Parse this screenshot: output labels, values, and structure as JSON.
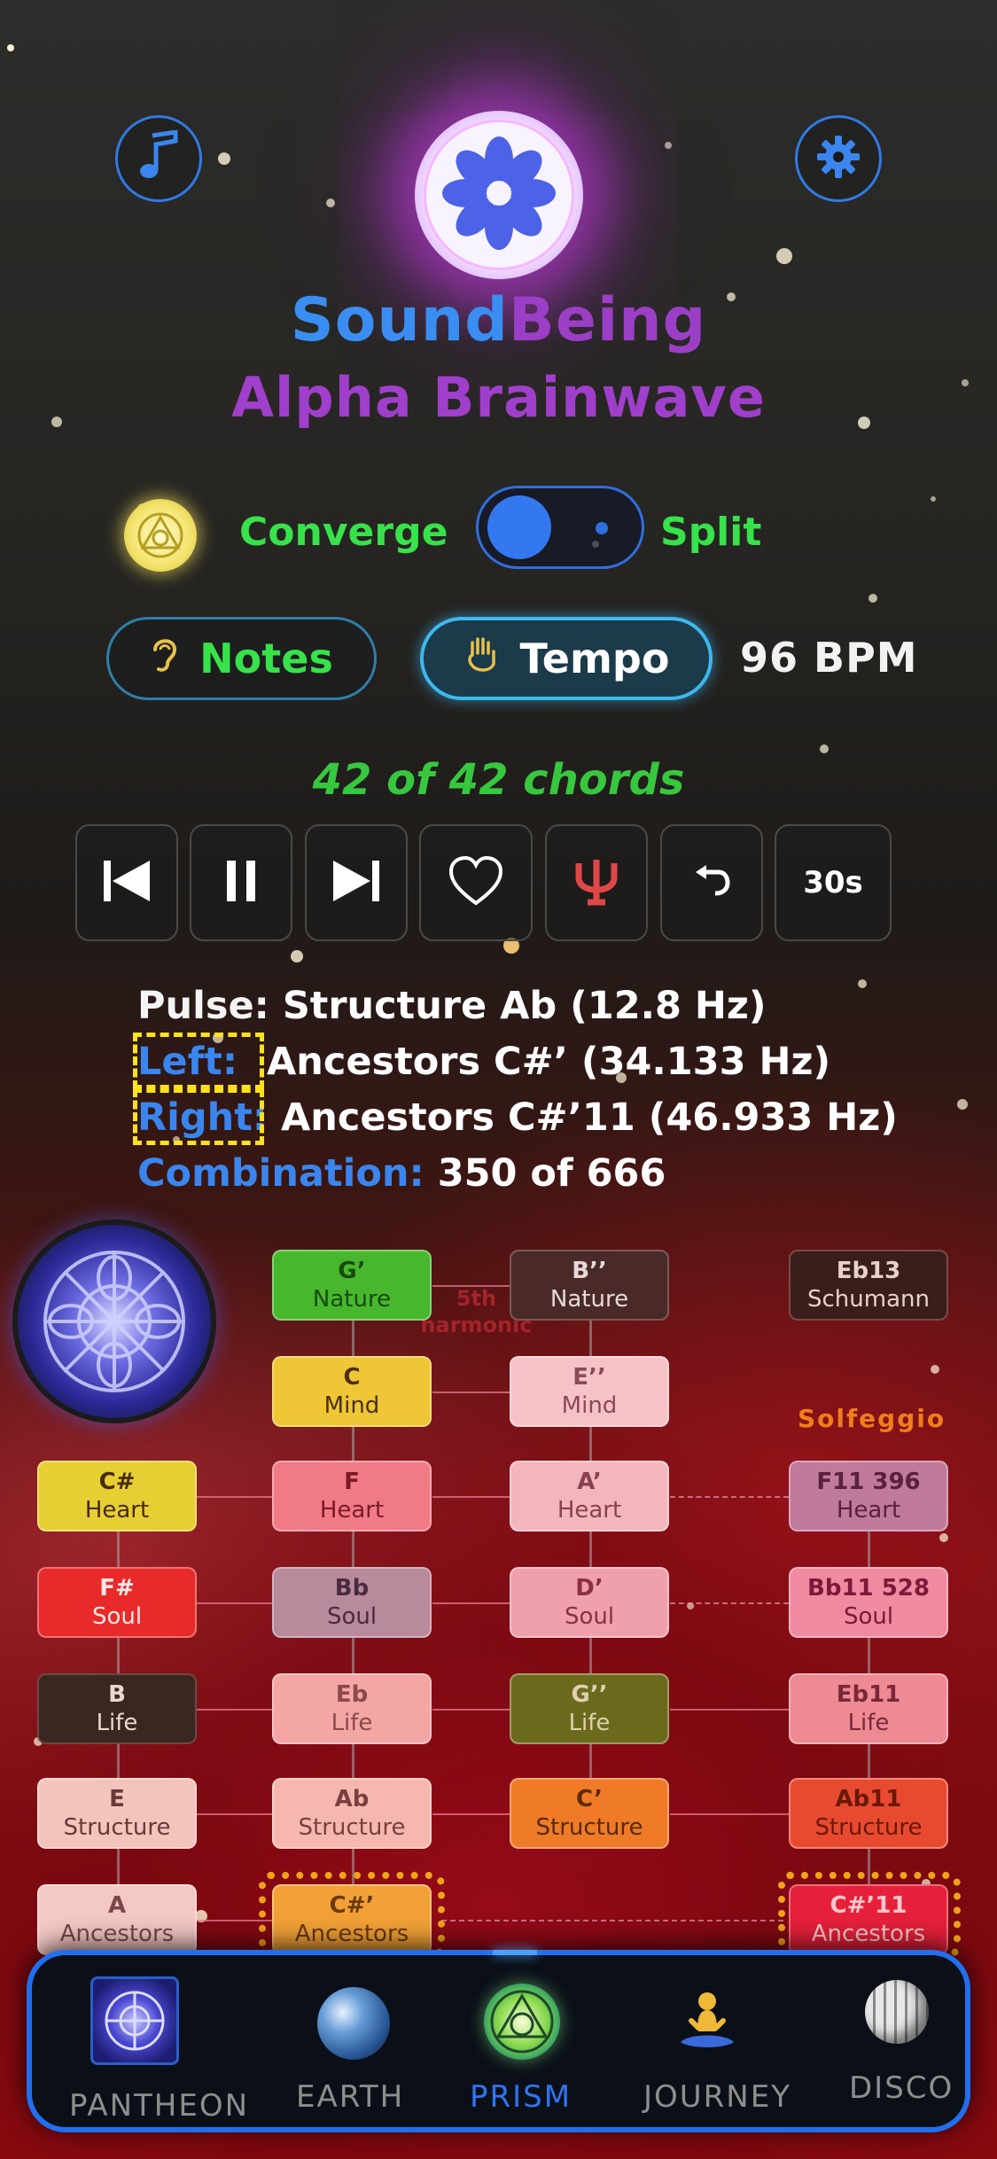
{
  "app": {
    "title_part1": "Sound",
    "title_part2": "Being",
    "subtitle": "Alpha Brainwave"
  },
  "header": {
    "music_button_icon": "music-note-icon",
    "settings_button_icon": "gear-icon",
    "logo_icon": "flower-logo-icon"
  },
  "mode": {
    "left_label": "Converge",
    "right_label": "Split",
    "toggle_state": "Converge"
  },
  "controls_row": {
    "notes_label": "Notes",
    "tempo_label": "Tempo",
    "bpm": "96 BPM"
  },
  "progress": {
    "chords_text": "42 of 42 chords"
  },
  "playback": {
    "timer_label": "30s",
    "icons": [
      "skip-back-icon",
      "pause-icon",
      "skip-forward-icon",
      "heart-icon",
      "psi-icon",
      "undo-icon"
    ]
  },
  "info": {
    "pulse_key": "Pulse:",
    "pulse_value": "Structure Ab (12.8 Hz)",
    "left_key": "Left:",
    "left_value": "Ancestors C#’ (34.133 Hz)",
    "right_key": "Right:",
    "right_value": "Ancestors C#’11 (46.933 Hz)",
    "combination_key": "Combination:",
    "combination_value": "350 of 666"
  },
  "grid": {
    "harmonic_label": "5th harmonic",
    "solfeggio_label": "Solfeggio",
    "nodes": {
      "c0r1": {
        "note": "C#",
        "name": "Heart"
      },
      "c0r2": {
        "note": "F#",
        "name": "Soul"
      },
      "c0r3": {
        "note": "B",
        "name": "Life"
      },
      "c0r4": {
        "note": "E",
        "name": "Structure"
      },
      "c0r5": {
        "note": "A",
        "name": "Ancestors"
      },
      "c1r_1": {
        "note": "G’",
        "name": "Nature"
      },
      "c1r0": {
        "note": "C",
        "name": "Mind"
      },
      "c1r1": {
        "note": "F",
        "name": "Heart"
      },
      "c1r2": {
        "note": "Bb",
        "name": "Soul"
      },
      "c1r3": {
        "note": "Eb",
        "name": "Life"
      },
      "c1r4": {
        "note": "Ab",
        "name": "Structure"
      },
      "c1r5": {
        "note": "C#’",
        "name": "Ancestors"
      },
      "c2r_1": {
        "note": "B’’",
        "name": "Nature"
      },
      "c2r0": {
        "note": "E’’",
        "name": "Mind"
      },
      "c2r1": {
        "note": "A’",
        "name": "Heart"
      },
      "c2r2": {
        "note": "D’",
        "name": "Soul"
      },
      "c2r3": {
        "note": "G’’",
        "name": "Life"
      },
      "c2r4": {
        "note": "C’",
        "name": "Structure"
      },
      "c3r_1": {
        "note": "Eb13",
        "name": "Schumann"
      },
      "c3r1": {
        "note": "F11 396",
        "name": "Heart"
      },
      "c3r2": {
        "note": "Bb11 528",
        "name": "Soul"
      },
      "c3r3": {
        "note": "Eb11",
        "name": "Life"
      },
      "c3r4": {
        "note": "Ab11",
        "name": "Structure"
      },
      "c3r5": {
        "note": "C#’11",
        "name": "Ancestors"
      }
    }
  },
  "tabs": [
    {
      "label": "PANTHEON",
      "icon": "pantheon-mandala-icon",
      "active": false
    },
    {
      "label": "EARTH",
      "icon": "earth-globe-icon",
      "active": false
    },
    {
      "label": "PRISM",
      "icon": "prism-triangle-icon",
      "active": true
    },
    {
      "label": "JOURNEY",
      "icon": "meditation-person-icon",
      "active": false
    },
    {
      "label": "DISCO",
      "icon": "disco-ball-icon",
      "active": false
    }
  ],
  "colors": {
    "accent_blue": "#2f7be6",
    "green": "#37e24a",
    "purple": "#a03fcb",
    "highlight_yellow": "#ffe21a",
    "active_tab": "#2f74f0"
  }
}
